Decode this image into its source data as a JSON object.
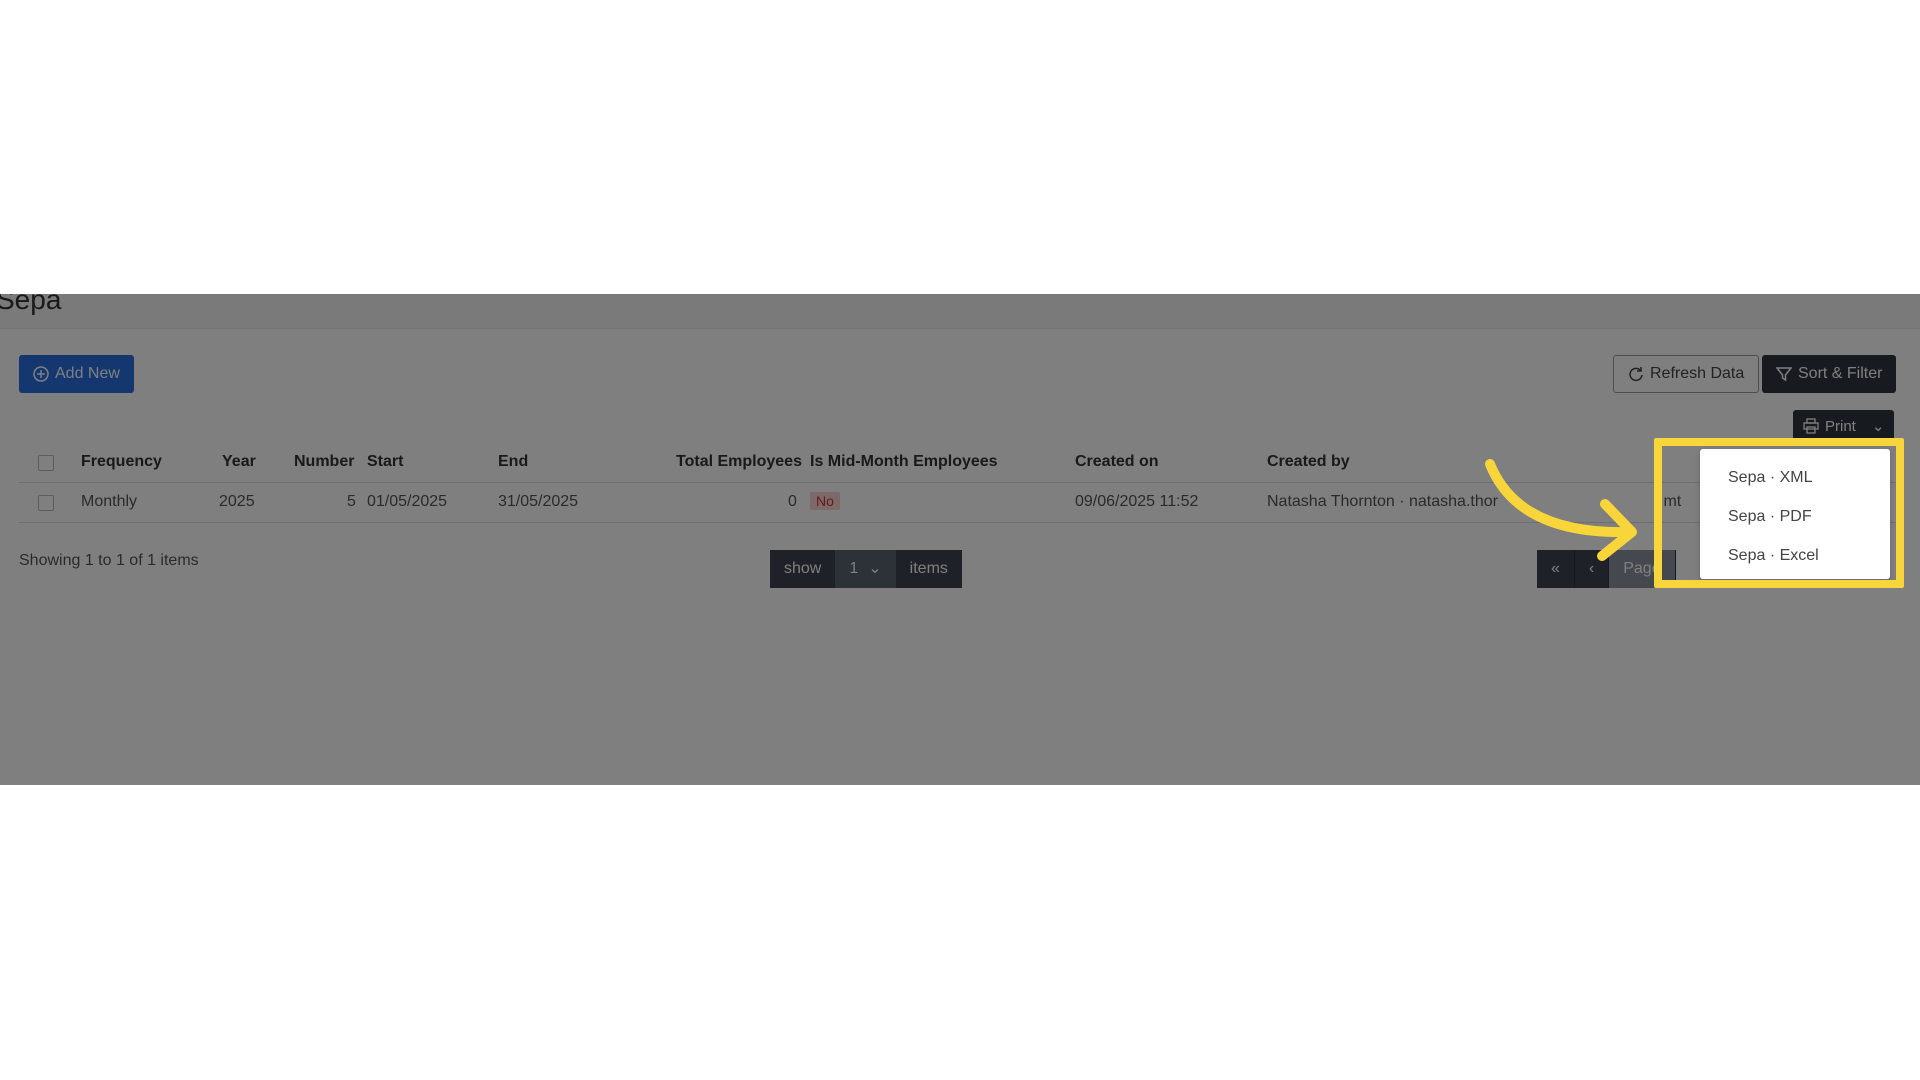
{
  "page": {
    "title": "Sepa"
  },
  "toolbar": {
    "add_new": "Add New",
    "refresh": "Refresh Data",
    "sort_filter": "Sort & Filter",
    "print": "Print"
  },
  "table": {
    "columns": [
      "Frequency",
      "Year",
      "Number",
      "Start",
      "End",
      "Total Employees",
      "Is Mid-Month Employees",
      "Created on",
      "Created by"
    ],
    "rows": [
      {
        "frequency": "Monthly",
        "year": "2025",
        "number": "5",
        "start": "01/05/2025",
        "end": "31/05/2025",
        "total_employees": "0",
        "mid_month": "No",
        "created_on": "09/06/2025 11:52",
        "created_by": "Natasha Thornton · natasha.thor",
        "created_by_tail": ".mt"
      }
    ]
  },
  "pagination": {
    "showing": "Showing 1 to 1 of 1 items",
    "show_label": "show",
    "page_size": "1",
    "items_label": "items",
    "page_label": "Page"
  },
  "print_menu": {
    "items": [
      "Sepa · XML",
      "Sepa · PDF",
      "Sepa · Excel"
    ]
  },
  "colors": {
    "highlight": "#f8d53a",
    "primary": "#2a6fe0",
    "dark": "#2f3640"
  }
}
